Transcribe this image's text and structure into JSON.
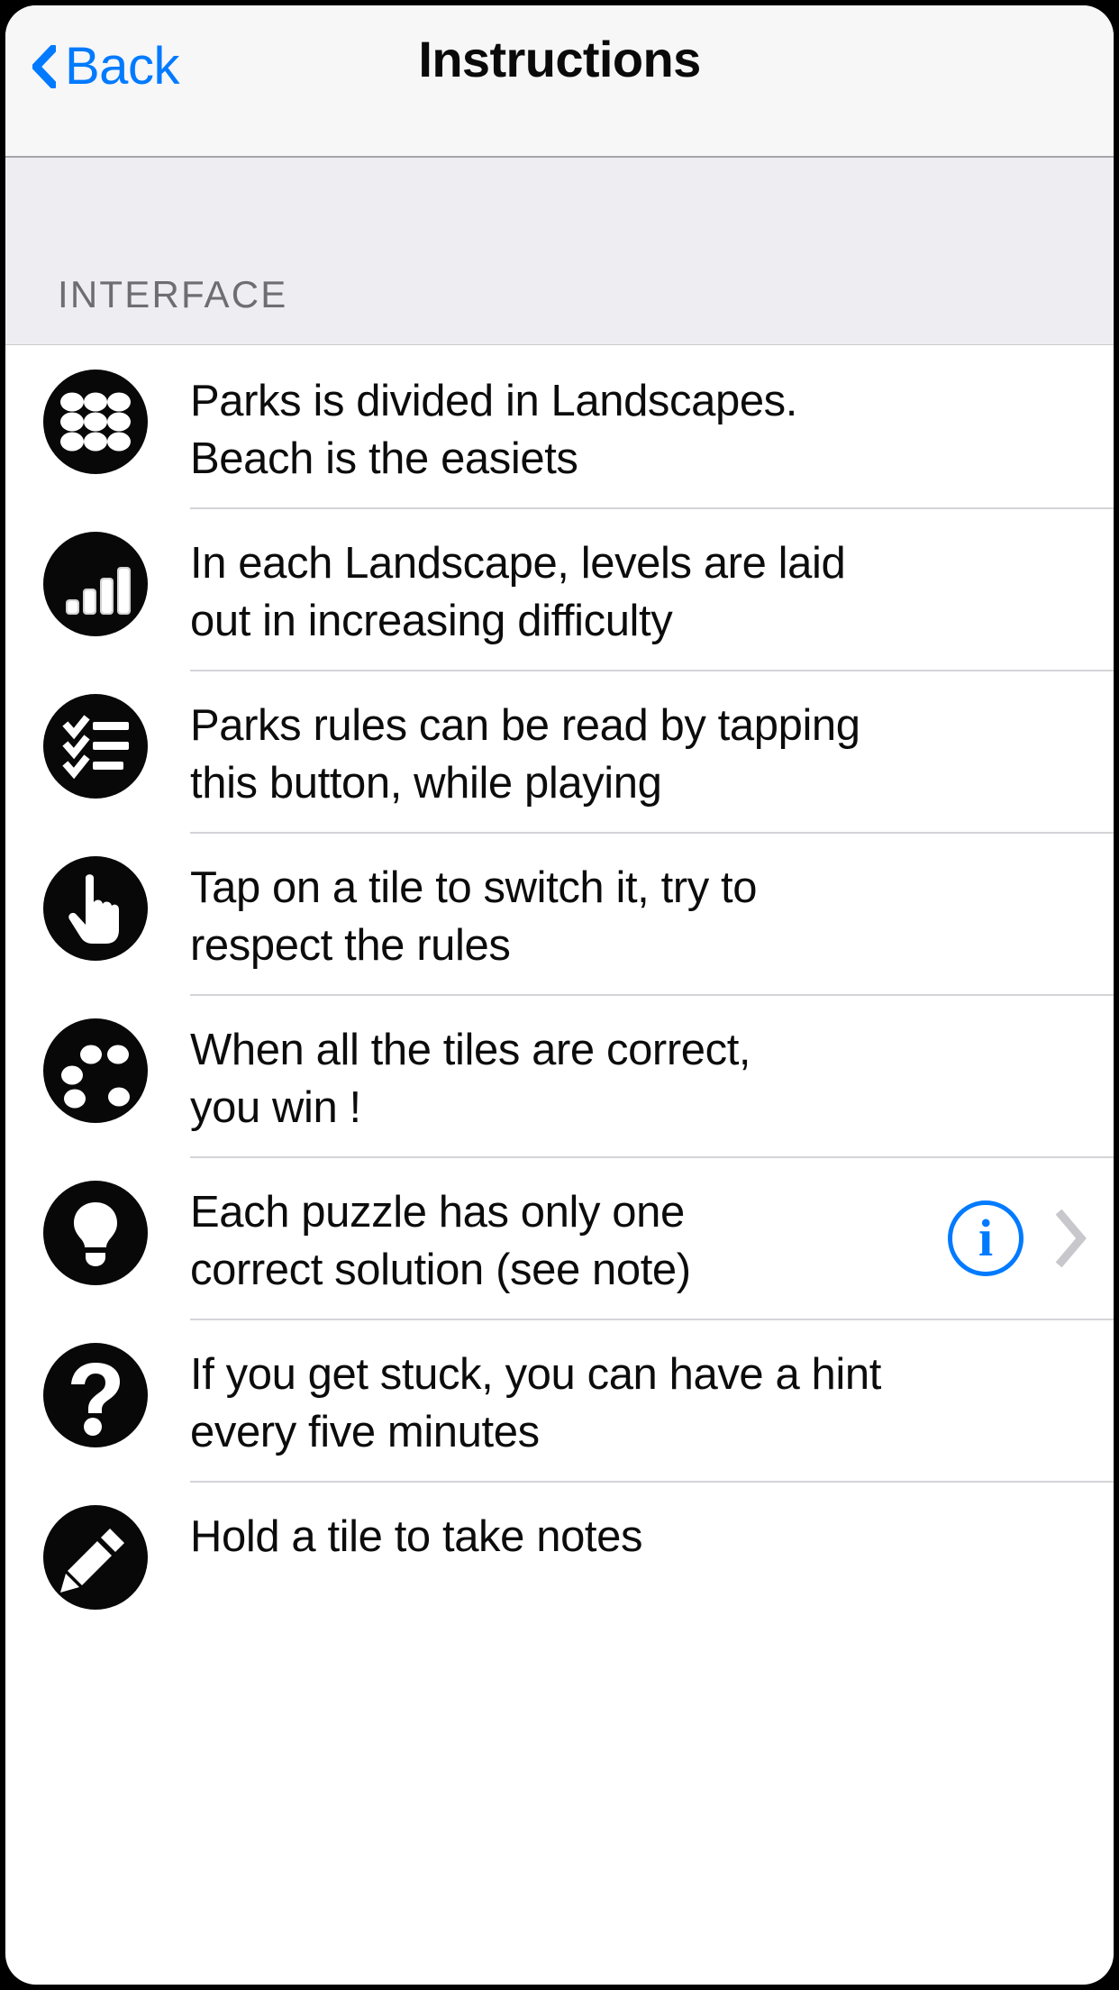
{
  "navbar": {
    "back_label": "Back",
    "back_icon": "chevron-left-icon",
    "title": "Instructions"
  },
  "section": {
    "header": "INTERFACE"
  },
  "colors": {
    "accent_blue": "#007aff",
    "icon_background": "#080808",
    "section_background": "#eeeef2",
    "navbar_background": "#f7f7f7",
    "separator": "#d4d4d8",
    "section_text": "#6d6d72",
    "disclosure_gray": "#c7c7cc"
  },
  "rows": [
    {
      "icon": "grid-dots-icon",
      "line1": "Parks is divided in Landscapes.",
      "line2": "Beach is the easiets",
      "accessory": "none"
    },
    {
      "icon": "signal-bars-icon",
      "line1": "In each Landscape, levels are laid",
      "line2": "out in increasing difficulty",
      "accessory": "none"
    },
    {
      "icon": "checklist-icon",
      "line1": "Parks rules can be read by tapping",
      "line2": "this button, while playing",
      "accessory": "none"
    },
    {
      "icon": "pointing-hand-icon",
      "line1": "Tap on a tile to switch it, try to",
      "line2": "respect the rules",
      "accessory": "none"
    },
    {
      "icon": "dice-dots-icon",
      "line1": "When all the tiles are correct,",
      "line2": "you win !",
      "accessory": "none"
    },
    {
      "icon": "lightbulb-icon",
      "line1": "Each puzzle has only one",
      "line2": "correct solution (see note)",
      "accessory": "info",
      "info_label": "i"
    },
    {
      "icon": "question-mark-icon",
      "line1": "If you get stuck, you can have a hint",
      "line2": "every five minutes",
      "accessory": "none"
    },
    {
      "icon": "pencil-icon",
      "line1": "Hold a tile to take notes",
      "line2": "",
      "accessory": "none"
    }
  ]
}
